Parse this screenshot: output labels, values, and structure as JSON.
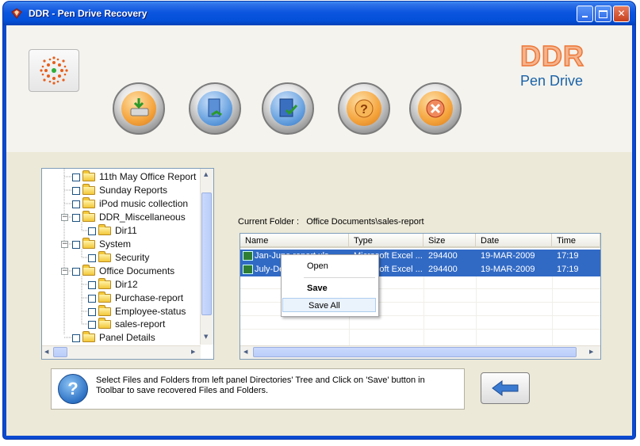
{
  "window": {
    "title": "DDR - Pen Drive Recovery",
    "controls": [
      "minimize",
      "maximize",
      "close"
    ]
  },
  "brand": {
    "name": "DDR",
    "product": "Pen Drive"
  },
  "toolbar": {
    "buttons": [
      {
        "name": "save-drive-icon",
        "color": "#f5a43c"
      },
      {
        "name": "open-door-icon",
        "color": "#2e73c5"
      },
      {
        "name": "book-check-icon",
        "color": "#2e73c5"
      },
      {
        "name": "help-icon",
        "color": "#f5a43c"
      },
      {
        "name": "exit-icon",
        "color": "#f5a43c"
      }
    ]
  },
  "tree": {
    "items": [
      {
        "label": "11th May Office Report"
      },
      {
        "label": "Sunday Reports"
      },
      {
        "label": "iPod music collection"
      },
      {
        "label": "DDR_Miscellaneous"
      },
      {
        "label": "Dir11"
      },
      {
        "label": "System"
      },
      {
        "label": "Security"
      },
      {
        "label": "Office Documents"
      },
      {
        "label": "Dir12"
      },
      {
        "label": "Purchase-report"
      },
      {
        "label": "Employee-status"
      },
      {
        "label": "sales-report"
      },
      {
        "label": "Panel Details"
      }
    ]
  },
  "current_folder": {
    "label": "Current Folder  :",
    "path": "Office Documents\\sales-report"
  },
  "file_list": {
    "columns": [
      "Name",
      "Type",
      "Size",
      "Date",
      "Time"
    ],
    "rows": [
      {
        "name": "Jan-June report.xls",
        "type": "Microsoft Excel ...",
        "size": "294400",
        "date": "19-MAR-2009",
        "time": "17:19"
      },
      {
        "name": "July-Dec report.xls",
        "type": "Microsoft Excel ...",
        "size": "294400",
        "date": "19-MAR-2009",
        "time": "17:19"
      }
    ]
  },
  "context_menu": {
    "open": "Open",
    "save": "Save",
    "save_all": "Save All"
  },
  "status": {
    "text": "Select Files and Folders from left panel Directories' Tree and Click on 'Save' button in Toolbar to save recovered Files and Folders."
  },
  "colors": {
    "titlebar": "#0b55df",
    "selection": "#316ac5",
    "brand": "#ee7636",
    "accent": "#1a63a8"
  }
}
